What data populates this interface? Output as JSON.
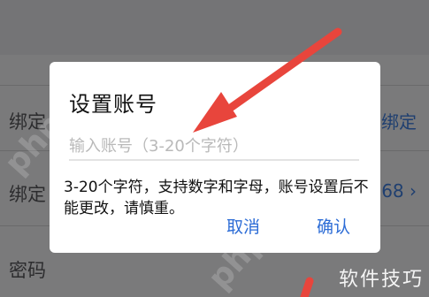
{
  "background": {
    "rows": [
      {
        "label": "绑定",
        "right": "绑定"
      },
      {
        "label": "绑定",
        "right": "68 ›"
      },
      {
        "label": "密码",
        "right": ""
      }
    ]
  },
  "dialog": {
    "title": "设置账号",
    "input_placeholder": "输入账号（3-20个字符）",
    "input_value": "",
    "hint": "3-20个字符，支持数字和字母，账号设置后不能更改，请慎重。",
    "cancel_label": "取消",
    "confirm_label": "确认"
  },
  "watermark": {
    "text": "软件技巧",
    "diagonal": "php.cn"
  },
  "colors": {
    "accent": "#2c6cd6",
    "annotation": "#e8453c",
    "overlay": "#7a7a7b"
  },
  "icons": {
    "annotation_arrow": "red-arrow"
  }
}
